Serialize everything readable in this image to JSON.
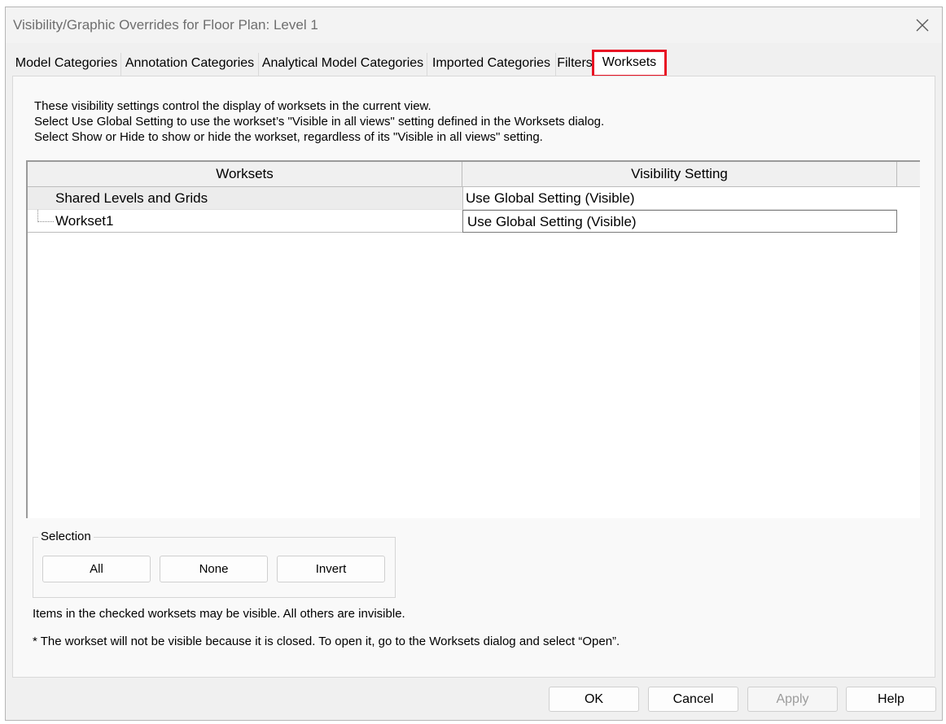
{
  "window": {
    "title": "Visibility/Graphic Overrides for Floor Plan: Level 1"
  },
  "tabs": [
    {
      "label": "Model Categories"
    },
    {
      "label": "Annotation Categories"
    },
    {
      "label": "Analytical Model Categories"
    },
    {
      "label": "Imported Categories"
    },
    {
      "label": "Filters"
    },
    {
      "label": "Worksets",
      "active": true
    }
  ],
  "description": {
    "line1": "These visibility settings control the display of worksets in the current view.",
    "line2": "Select Use Global Setting to use the workset’s \"Visible in all views\" setting defined in the Worksets dialog.",
    "line3": "Select Show or Hide to show or hide the workset, regardless of its \"Visible in all views\" setting."
  },
  "grid": {
    "columns": [
      "Worksets",
      "Visibility Setting"
    ],
    "rows": [
      {
        "workset": "Shared Levels and Grids",
        "visibility": "Use Global Setting (Visible)"
      },
      {
        "workset": "Workset1",
        "visibility": "Use Global Setting (Visible)"
      }
    ]
  },
  "selection": {
    "label": "Selection",
    "all": "All",
    "none": "None",
    "invert": "Invert"
  },
  "notes": {
    "checked": "Items in the checked worksets may be visible.  All others are invisible.",
    "closed": "* The workset will not be visible because it is closed. To open it, go to the Worksets dialog and select “Open”."
  },
  "footer": {
    "ok": "OK",
    "cancel": "Cancel",
    "apply": "Apply",
    "help": "Help"
  },
  "icons": {
    "close": "close-icon"
  }
}
